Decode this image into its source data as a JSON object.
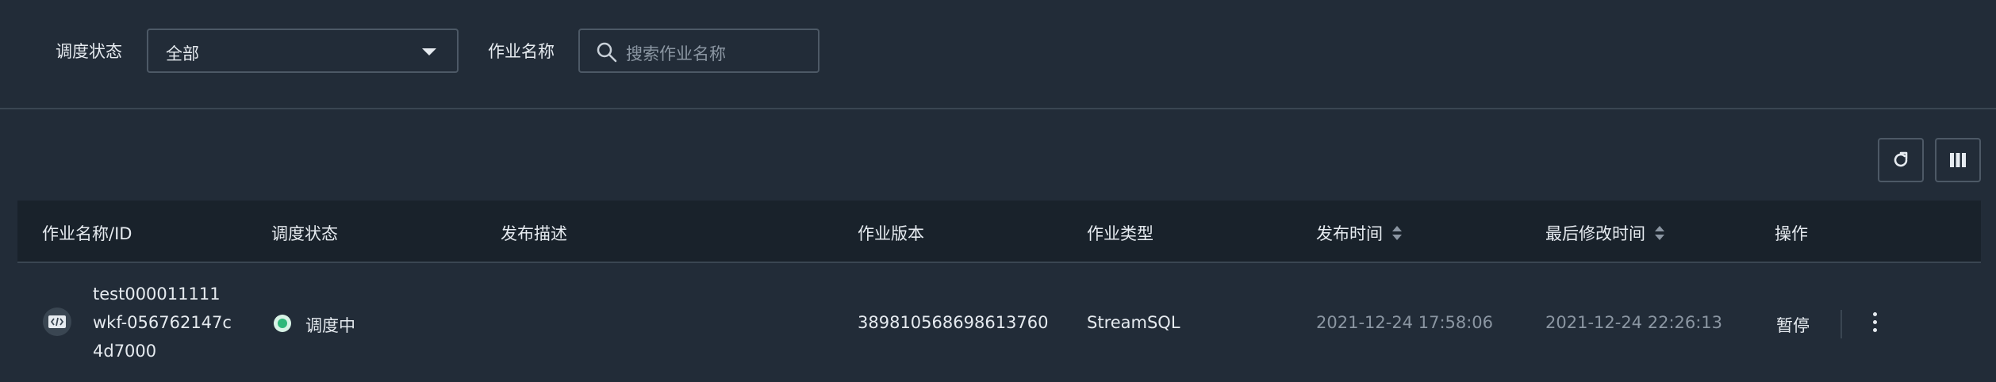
{
  "filters": {
    "status_label": "调度状态",
    "status_value": "全部",
    "name_label": "作业名称",
    "name_placeholder": "搜索作业名称"
  },
  "toolbar": {
    "refresh_icon": "refresh-icon",
    "columns_icon": "columns-icon"
  },
  "table": {
    "headers": [
      "作业名称/ID",
      "调度状态",
      "发布描述",
      "作业版本",
      "作业类型",
      "发布时间",
      "最后修改时间",
      "操作"
    ],
    "rows": [
      {
        "name_line1": "test000011111",
        "name_line2": "wkf-056762147c",
        "name_line3": "4d7000",
        "status": "调度中",
        "description": "",
        "version": "389810568698613760",
        "type": "StreamSQL",
        "publish_time": "2021-12-24 17:58:06",
        "modified_time": "2021-12-24 22:26:13",
        "action": "暂停"
      }
    ]
  },
  "colors": {
    "background": "#222c38",
    "header_background": "#19222b",
    "status_green": "#2fb87a"
  }
}
